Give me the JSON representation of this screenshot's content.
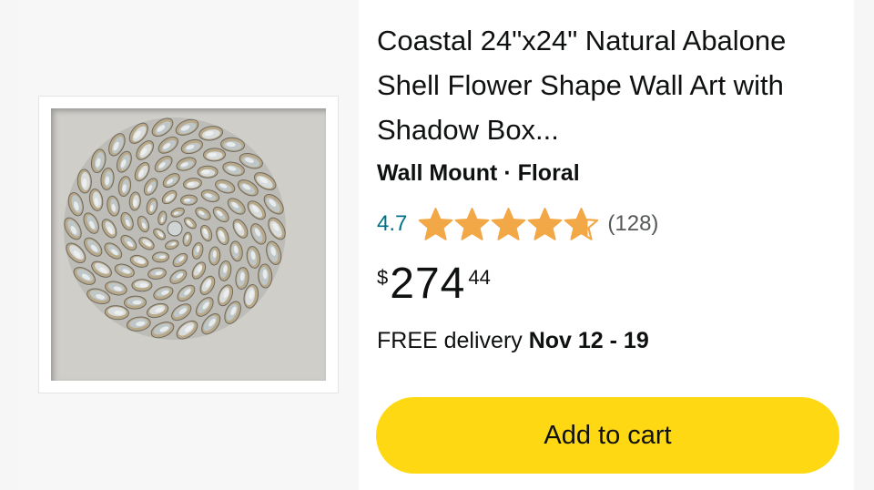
{
  "product": {
    "title": "Coastal 24\"x24\" Natural Abalone Shell Flower Shape Wall Art with Shadow Box...",
    "variant": "Wall Mount · Floral",
    "rating": {
      "value_text": "4.7",
      "value": 4.7,
      "max": 5,
      "review_count_text": "(128)",
      "star_color": "#f3a847"
    },
    "price": {
      "symbol": "$",
      "whole": "274",
      "fraction": "44"
    },
    "delivery": {
      "prefix": "FREE delivery",
      "dates": "Nov 12 - 19"
    },
    "image": {
      "icon": "abalone-shell-flower-shadow-box-image"
    }
  },
  "actions": {
    "add_to_cart_label": "Add to cart",
    "button_color": "#ffd814"
  },
  "colors": {
    "rating_link": "#007185",
    "text": "#0f1111",
    "muted": "#565959"
  }
}
